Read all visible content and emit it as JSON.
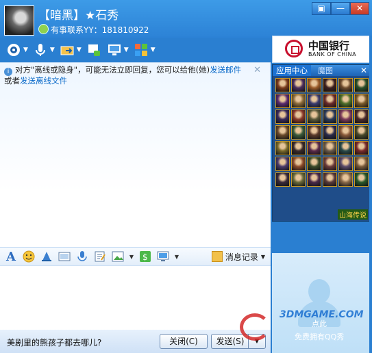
{
  "contact": {
    "name": "【暗黑】★石秀",
    "signature": "有事联系YY：181810922"
  },
  "window_buttons": {
    "restore": "▣",
    "minimize": "—",
    "close": "✕"
  },
  "toolbar": {
    "items": [
      {
        "icon": "webcam-icon"
      },
      {
        "icon": "microphone-icon"
      },
      {
        "icon": "file-transfer-icon"
      },
      {
        "icon": "sms-icon"
      },
      {
        "icon": "remote-desktop-icon"
      },
      {
        "icon": "apps-grid-icon"
      }
    ]
  },
  "ad": {
    "bank_cn": "中国银行",
    "bank_en": "BANK OF CHINA",
    "brand_color": "#c8102e"
  },
  "notice": {
    "text_before": "对方\"离线或隐身\"，可能无法立即回复，您可以给他(她)",
    "link_mail": "发送邮件",
    "text_mid": "或者",
    "link_file": "发送离线文件"
  },
  "app_center": {
    "title": "应用中心",
    "tab2": "魔图",
    "game_name": "山海传说",
    "tile_colors": [
      "#7a3b1c",
      "#4a2d5c",
      "#9a5b2a",
      "#3c1f1f",
      "#6e4b2e",
      "#2a4f2a",
      "#5c2b6e",
      "#8a6a3a",
      "#3a3a6e",
      "#6a2a2a",
      "#4e6e2a",
      "#7a5a2a",
      "#3a2a5a",
      "#8a3a2a",
      "#5a5a3a",
      "#2a3a5a",
      "#7a3a5a",
      "#4a2a2a",
      "#6a4a2a",
      "#3a5a3a",
      "#5a3a2a",
      "#2a2a4a",
      "#8a5a3a",
      "#4a4a2a",
      "#7a6a2a",
      "#3a2a2a",
      "#5a2a4a",
      "#6a5a4a",
      "#2a4a4a",
      "#7a2a2a",
      "#4a3a6a",
      "#8a4a2a",
      "#3a4a2a",
      "#6a3a3a",
      "#5a4a6a",
      "#7a5a3a",
      "#3a2a3a",
      "#6a6a3a",
      "#4a2a4a",
      "#5a3a3a",
      "#8a6a4a",
      "#2a5a2a"
    ]
  },
  "input_toolbar": {
    "history_label": "消息记录"
  },
  "bottom": {
    "ad_text": "美剧里的熊孩子都去哪儿?",
    "close_label": "关闭(C)",
    "send_label": "发送(S)"
  },
  "show": {
    "click_text": "点此",
    "free_text": "免费拥有QQ秀"
  },
  "watermark": {
    "site": "3DMGAME.COM"
  }
}
